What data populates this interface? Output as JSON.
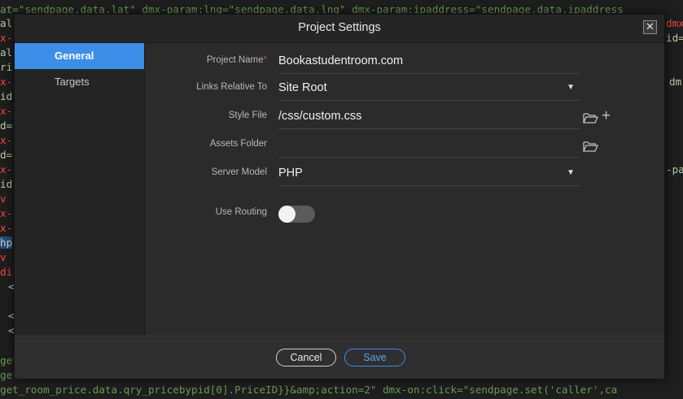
{
  "editor": {
    "top_line": "at=\"sendpage.data.lat\" dmx-param:lng=\"sendpage.data.lng\" dmx-param:ipaddress=\"sendpage.data.ipaddress",
    "bottom_lines": [
      "get_room_price.data.qry_pricebypid[0].PriceID}}&amp;action=2\" dmx-on:click=\"sendpage.set('caller',ca"
    ],
    "partial_lines": [
      "get",
      "get"
    ],
    "gutter_frags": [
      "al",
      "x-",
      "al",
      "ri",
      "x-",
      "id",
      "x-",
      "d=",
      "x-",
      "d=",
      "x-",
      "id",
      "v",
      "x-",
      "x-",
      "hp",
      "v",
      "di",
      "<",
      "<",
      "<"
    ],
    "right_frags": [
      "dmx",
      "id=",
      "dm",
      "-pa"
    ]
  },
  "dialog": {
    "title": "Project Settings",
    "close_glyph": "✕",
    "sidebar": [
      {
        "label": "General",
        "active": true
      },
      {
        "label": "Targets",
        "active": false
      }
    ],
    "fields": {
      "project_name": {
        "label": "Project Name",
        "required_mark": "*",
        "value": "Bookastudentroom.com"
      },
      "links_relative_to": {
        "label": "Links Relative To",
        "value": "Site Root"
      },
      "style_file": {
        "label": "Style File",
        "value": "/css/custom.css"
      },
      "assets_folder": {
        "label": "Assets Folder",
        "value": ""
      },
      "server_model": {
        "label": "Server Model",
        "value": "PHP"
      },
      "use_routing": {
        "label": "Use Routing",
        "enabled": false
      }
    },
    "dropdown_caret": "▼",
    "plus_glyph": "+",
    "buttons": {
      "cancel": "Cancel",
      "save": "Save"
    }
  },
  "colors": {
    "accent": "#3d8ee8",
    "required": "#e04a4a"
  }
}
